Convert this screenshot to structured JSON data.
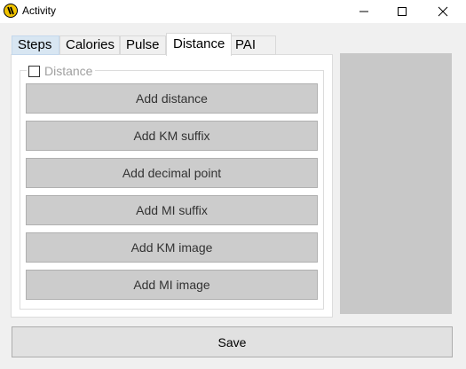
{
  "window": {
    "title": "Activity",
    "icon": "app-logo-icon",
    "controls": [
      "minimize-icon",
      "maximize-icon",
      "close-icon"
    ]
  },
  "tabs": [
    {
      "label": "Steps",
      "state": "hover"
    },
    {
      "label": "Calories",
      "state": "normal"
    },
    {
      "label": "Pulse",
      "state": "normal"
    },
    {
      "label": "Distance",
      "state": "selected"
    },
    {
      "label": "PAI",
      "state": "normal"
    }
  ],
  "distance_group": {
    "label": "Distance",
    "checked": false,
    "buttons": [
      "Add distance",
      "Add KM suffix",
      "Add decimal point",
      "Add MI suffix",
      "Add KM image",
      "Add MI image"
    ]
  },
  "save_label": "Save"
}
